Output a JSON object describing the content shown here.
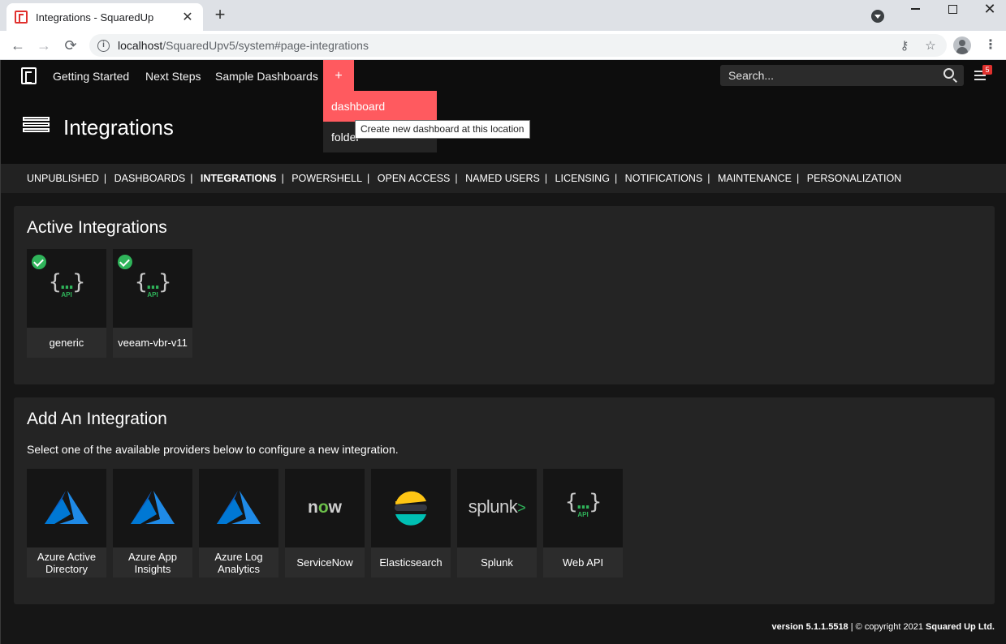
{
  "browser": {
    "tab_title": "Integrations - SquaredUp",
    "tab_close": "✕",
    "new_tab": "+",
    "url_host": "localhost",
    "url_path": "/SquaredUpv5/system#page-integrations"
  },
  "nav": {
    "items": [
      "Getting Started",
      "Next Steps",
      "Sample Dashboards"
    ],
    "plus_label": "+",
    "search_placeholder": "Search...",
    "notification_count": "5"
  },
  "dropdown": {
    "items": [
      "dashboard",
      "folder"
    ],
    "tooltip": "Create new dashboard at this location"
  },
  "page": {
    "title": "Integrations"
  },
  "subnav": {
    "items": [
      "UNPUBLISHED",
      "DASHBOARDS",
      "INTEGRATIONS",
      "POWERSHELL",
      "OPEN ACCESS",
      "NAMED USERS",
      "LICENSING",
      "NOTIFICATIONS",
      "MAINTENANCE",
      "PERSONALIZATION"
    ],
    "active": "INTEGRATIONS"
  },
  "active_integrations": {
    "title": "Active Integrations",
    "items": [
      {
        "label": "generic",
        "icon": "api-icon"
      },
      {
        "label": "veeam-vbr-v11",
        "icon": "api-icon"
      }
    ]
  },
  "add_integration": {
    "title": "Add An Integration",
    "description": "Select one of the available providers below to configure a new integration.",
    "providers": [
      {
        "label": "Azure Active Directory",
        "icon": "azure-icon"
      },
      {
        "label": "Azure App Insights",
        "icon": "azure-icon"
      },
      {
        "label": "Azure Log Analytics",
        "icon": "azure-icon"
      },
      {
        "label": "ServiceNow",
        "icon": "servicenow-icon"
      },
      {
        "label": "Elasticsearch",
        "icon": "elasticsearch-icon"
      },
      {
        "label": "Splunk",
        "icon": "splunk-icon"
      },
      {
        "label": "Web API",
        "icon": "api-icon"
      }
    ]
  },
  "logos": {
    "api_text": "API",
    "now_text_n": "n",
    "now_text_o": "o",
    "now_text_w": "w",
    "splunk_text": "splunk",
    "splunk_gt": ">"
  },
  "footer": {
    "version": "version 5.1.1.5518",
    "copyright": " | © copyright 2021 ",
    "brand": "Squared Up Ltd."
  },
  "colors": {
    "accent": "#ff5a5f",
    "success": "#2fb45a",
    "azure_blue": "#0078d4",
    "elastic_yellow": "#fec514",
    "elastic_teal": "#00bfb3"
  }
}
